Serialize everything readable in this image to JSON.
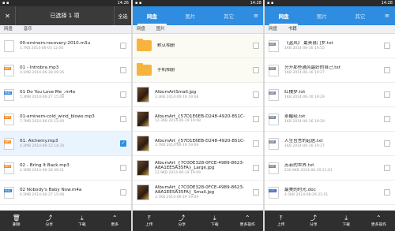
{
  "status": {
    "left_time": "14:26",
    "mid_time": "14:28",
    "right_time": "14:28"
  },
  "panel1": {
    "topbar": {
      "close": "✕",
      "title": "已选择 1 项",
      "select_all": "全选"
    },
    "crumb": [
      "网盘",
      "音乐"
    ],
    "rows": [
      {
        "type": "m3u",
        "name": "00-eminem-recovery-2010.m3u",
        "meta": "1.7KB   2014-06-03 12:00"
      },
      {
        "type": "mp3",
        "name": "01 - Introbra.mp3",
        "meta": "4.1MB   2014-06-28 09:26"
      },
      {
        "type": "m4a",
        "name": "01 Do You Love Me_.m4a",
        "meta": "5.3MB   2014-06-27 15:08"
      },
      {
        "type": "mp3",
        "name": "01-eminem-cold_wind_blows.mp3",
        "meta": "7.7MB   2014-06-03 12:00"
      },
      {
        "type": "mp3",
        "name": "01. Alchemy.mp3",
        "meta": "4.2MB   2014-06-13 14:34",
        "checked": true
      },
      {
        "type": "mp3",
        "name": "02 - Bring It Back.mp3",
        "meta": "4.3MB   2014-06-28 09:21"
      },
      {
        "type": "m4a",
        "name": "02 Nobody's Baby Now.m4a",
        "meta": "6.5MB   2014-06-27 15:08"
      }
    ],
    "bottom": [
      {
        "icon": "🗑",
        "label": "删除"
      },
      {
        "icon": "⤴",
        "label": "分享"
      },
      {
        "icon": "⤓",
        "label": "下载"
      },
      {
        "icon": "⌃",
        "label": "更多"
      }
    ]
  },
  "panel2": {
    "topbar": {
      "tabs": [
        "网盘",
        "图片",
        "其它"
      ]
    },
    "crumb": [
      "网盘",
      "图片"
    ],
    "rows": [
      {
        "type": "folder",
        "name": "默认相册"
      },
      {
        "type": "folder",
        "name": "手机相册"
      },
      {
        "type": "img",
        "name": "AlbumArtSmall.jpg",
        "meta": "3.3KB   2014-06-19 19:08"
      },
      {
        "type": "img",
        "name": "AlbumArt_{57D1E6EB-D248-4920-851C-",
        "meta": "12.3KB   2014-06-19 19:08"
      },
      {
        "type": "img",
        "name": "AlbumArt_{57D1E6EB-D248-4920-851C-",
        "meta": "3.7KB   2014-06-19 19:09"
      },
      {
        "type": "img",
        "name": "AlbumArt_{7C0DE328-0FCE-4989-8623-A8A1EE5A35FA}_Large.jpg",
        "meta": "12.9KB   2014-06-19 19:09"
      },
      {
        "type": "img",
        "name": "AlbumArt_{7C0DE328-0FCE-4989-8623-A8A1EE5A35FA}_Small.jpg",
        "meta": "3.7KB   2014-06-19 19:09"
      }
    ],
    "bottom": [
      {
        "icon": "⤒",
        "label": "上传"
      },
      {
        "icon": "⤴",
        "label": "分享"
      },
      {
        "icon": "⤓",
        "label": "下载"
      },
      {
        "icon": "⌃",
        "label": "更多操作"
      }
    ]
  },
  "panel3": {
    "topbar": {
      "tabs": [
        "网盘",
        "图片",
        "其它"
      ]
    },
    "crumb": [
      "网盘",
      "书籍"
    ],
    "rows": [
      {
        "type": "txt",
        "name": "《盗风》 最贵县门罗.txt",
        "meta": "1KB   2014-06-16 19:55"
      },
      {
        "type": "txt",
        "name": "分开那些通风最好的自己.txt",
        "meta": "1KB   2014-06-16 19:27"
      },
      {
        "type": "txt",
        "name": "红楼梦.txt",
        "meta": "1KB   2014-06-16 19:29"
      },
      {
        "type": "txt",
        "name": "茶醒经.txt",
        "meta": "1KB   2014-06-16 19:29"
      },
      {
        "type": "txt",
        "name": "人生哲言的起居.txt",
        "meta": "1KB   2014-06-16 19:27"
      },
      {
        "type": "txt",
        "name": "苏菲的世界.txt",
        "meta": "230.9KB   2014-06-29 21:01"
      },
      {
        "type": "doc",
        "name": "最美的时光.doc",
        "meta": "4.5KB   2014-06-29 21:01"
      }
    ],
    "bottom": [
      {
        "icon": "⤒",
        "label": "上传"
      },
      {
        "icon": "⤴",
        "label": "分享"
      },
      {
        "icon": "⤓",
        "label": "下载"
      },
      {
        "icon": "⌃",
        "label": "更多操作"
      }
    ]
  }
}
